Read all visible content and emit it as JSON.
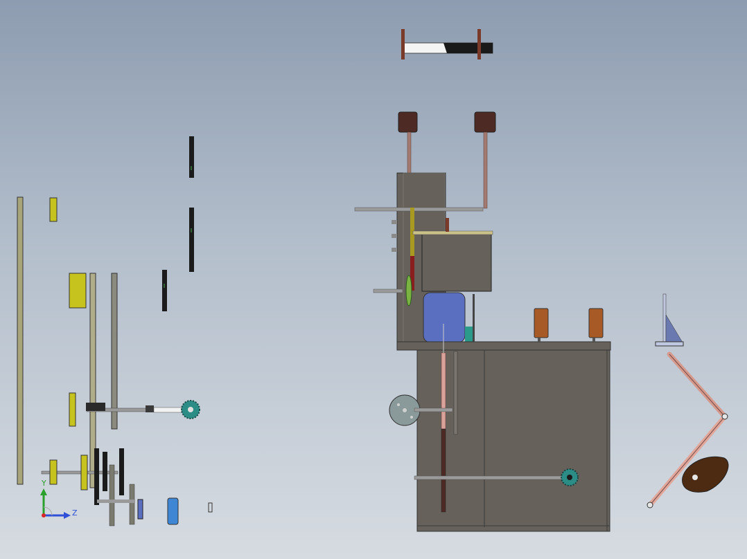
{
  "view": {
    "axes": {
      "y_label": "Y",
      "z_label": "Z"
    },
    "colors": {
      "background_top": "#8d9cb0",
      "background_bottom": "#d6dbe1",
      "frame_gray": "#66615b",
      "yellow_part": "#c6c21e",
      "shaft_gray": "#9a9a9a",
      "copper_rod": "#d9a29a",
      "dark_brown": "#4d2a23",
      "teal_gear": "#2c8c86",
      "blue_part": "#5a6fc0",
      "orange_block": "#a85a26"
    }
  }
}
